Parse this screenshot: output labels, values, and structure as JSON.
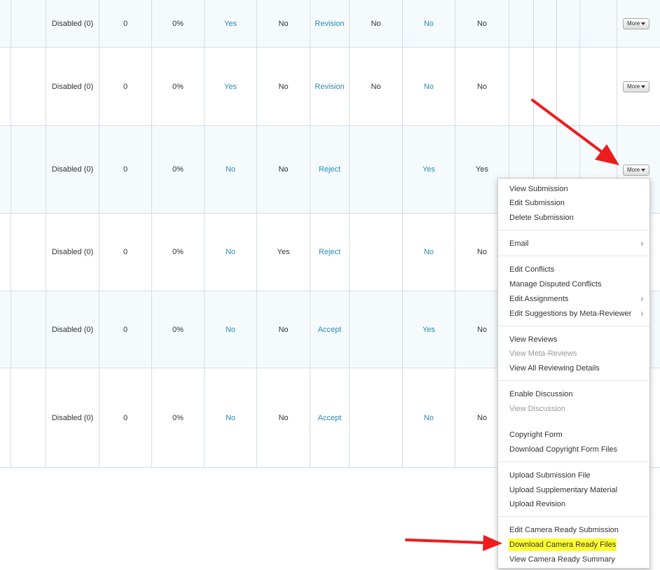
{
  "table": {
    "rows": [
      {
        "cells": [
          "",
          "",
          "Disabled (0)",
          "0",
          "0%",
          "Yes",
          "No",
          "Revision",
          "No",
          "No",
          "No",
          "",
          "",
          "",
          ""
        ],
        "more_label": "More"
      },
      {
        "cells": [
          "",
          "",
          "Disabled (0)",
          "0",
          "0%",
          "Yes",
          "No",
          "Revision",
          "No",
          "No",
          "No",
          "",
          "",
          "",
          ""
        ],
        "more_label": "More"
      },
      {
        "cells": [
          "",
          "",
          "Disabled (0)",
          "0",
          "0%",
          "No",
          "No",
          "Reject",
          "",
          "Yes",
          "Yes",
          "",
          "",
          "",
          ""
        ],
        "more_label": "More"
      },
      {
        "cells": [
          "",
          "",
          "Disabled (0)",
          "0",
          "0%",
          "No",
          "Yes",
          "Reject",
          "",
          "No",
          "No",
          "",
          "",
          "",
          ""
        ],
        "more_label": ""
      },
      {
        "cells": [
          "",
          "",
          "Disabled (0)",
          "0",
          "0%",
          "No",
          "No",
          "Accept",
          "",
          "Yes",
          "No",
          "",
          "",
          "",
          ""
        ],
        "more_label": ""
      },
      {
        "cells": [
          "",
          "",
          "Disabled (0)",
          "0",
          "0%",
          "No",
          "No",
          "Accept",
          "",
          "No",
          "No",
          "",
          "",
          "",
          ""
        ],
        "more_label": ""
      }
    ]
  },
  "context_menu": {
    "groups": [
      [
        {
          "label": "View Submission"
        },
        {
          "label": "Edit Submission"
        },
        {
          "label": "Delete Submission"
        }
      ],
      [
        {
          "label": "Email",
          "submenu": true
        }
      ],
      [
        {
          "label": "Edit Conflicts"
        },
        {
          "label": "Manage Disputed Conflicts"
        },
        {
          "label": "Edit Assignments",
          "submenu": true
        },
        {
          "label": "Edit Suggestions by Meta-Reviewer",
          "submenu": true
        }
      ],
      [
        {
          "label": "View Reviews"
        },
        {
          "label": "View Meta-Reviews",
          "disabled": true
        },
        {
          "label": "View All Reviewing Details"
        }
      ],
      [
        {
          "label": "Enable Discussion"
        },
        {
          "label": "View Discussion",
          "disabled": true
        }
      ],
      [
        {
          "label": "Copyright Form"
        },
        {
          "label": "Download Copyright Form Files"
        }
      ],
      [
        {
          "label": "Upload Submission File"
        },
        {
          "label": "Upload Supplementary Material"
        },
        {
          "label": "Upload Revision"
        }
      ],
      [
        {
          "label": "Edit Camera Ready Submission"
        },
        {
          "label": "Download Camera Ready Files",
          "highlighted": true
        },
        {
          "label": "View Camera Ready Summary"
        }
      ]
    ]
  },
  "colors": {
    "link": "#2a8bb5",
    "highlight": "#ffff2e",
    "arrow": "#ee1c1c",
    "row_alt": "#f5fafd"
  }
}
